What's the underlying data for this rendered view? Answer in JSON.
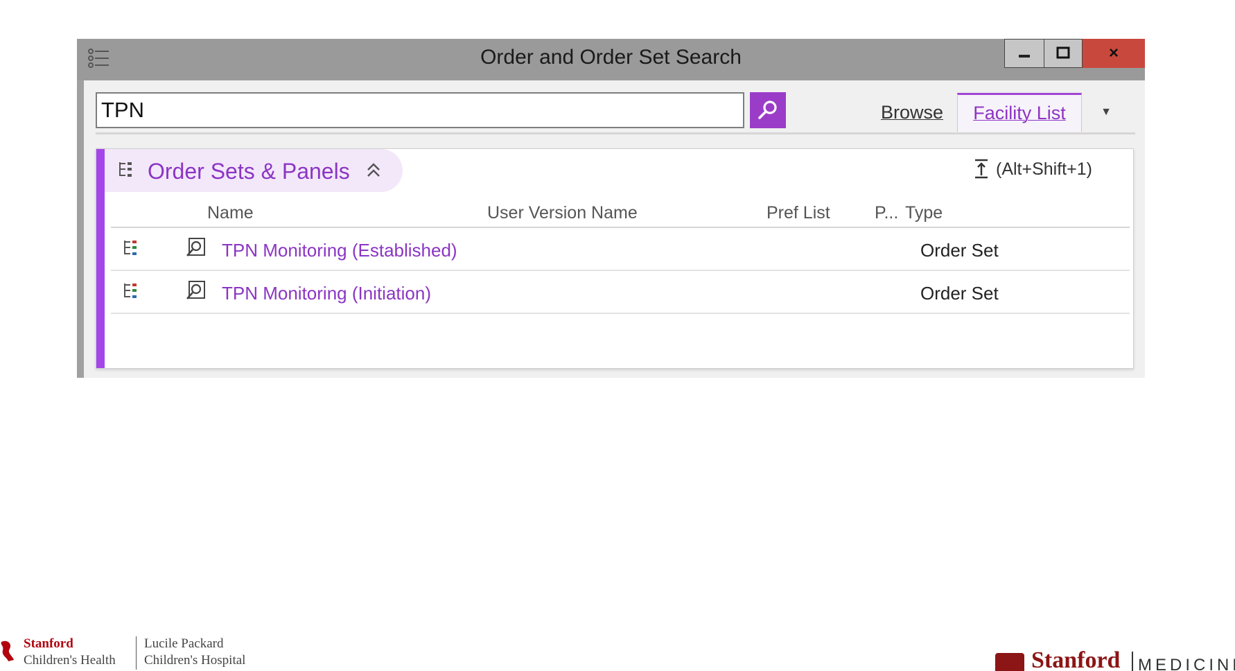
{
  "window": {
    "title": "Order and Order Set Search",
    "controls": {
      "minimize": "minimize",
      "maximize": "maximize",
      "close": "×"
    }
  },
  "search": {
    "value": "TPN",
    "placeholder": ""
  },
  "tabs": [
    {
      "label": "Browse",
      "selected": false
    },
    {
      "label": "Facility List",
      "selected": true
    }
  ],
  "section": {
    "title": "Order Sets & Panels",
    "collapse_shortcut": "(Alt+Shift+1)"
  },
  "columns": [
    "Name",
    "User Version Name",
    "Pref List",
    "P...",
    "Type"
  ],
  "rows": [
    {
      "name": "TPN Monitoring (Established)",
      "user_version_name": "",
      "pref_list": "",
      "p": "",
      "type": "Order Set"
    },
    {
      "name": "TPN Monitoring (Initiation)",
      "user_version_name": "",
      "pref_list": "",
      "p": "",
      "type": "Order Set"
    }
  ],
  "footer": {
    "left_logo": {
      "line1": "Stanford",
      "line2": "Children's Health",
      "line3": "Lucile Packard",
      "line4": "Children's Hospital"
    },
    "right_logo": {
      "word": "Stanford",
      "sub": "MEDICINE"
    }
  },
  "colors": {
    "accent": "#a445ea",
    "link": "#8b35c3",
    "title_bar": "#9a9a9a",
    "close_button": "#c9483d"
  },
  "icons": [
    "menu-icon",
    "search-icon",
    "dropdown-arrow-icon",
    "order-set-icon",
    "collapse-all-icon",
    "preview-icon",
    "chevron-up-double-icon"
  ]
}
